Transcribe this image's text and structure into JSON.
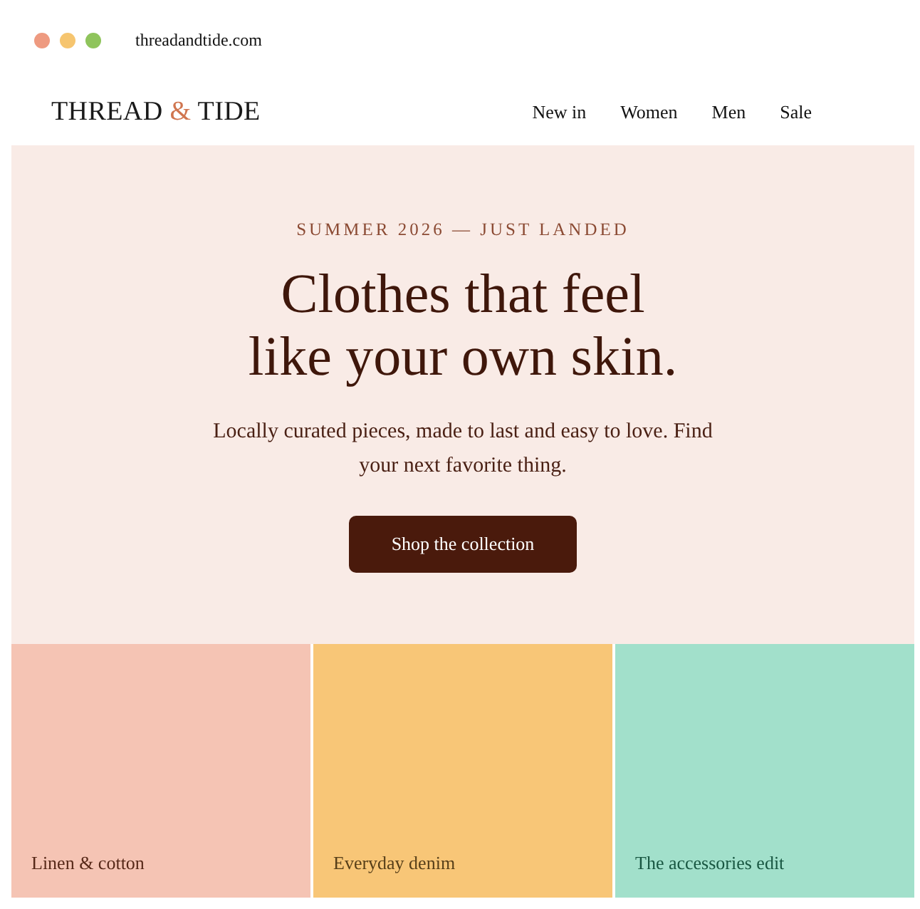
{
  "browser": {
    "dots": [
      {
        "color": "#ee9a80"
      },
      {
        "color": "#f6c56f"
      },
      {
        "color": "#8fc45c"
      }
    ],
    "url": "threadandtide.com"
  },
  "header": {
    "logo": {
      "before": "THREAD",
      "accent": "&",
      "after": "TIDE"
    },
    "nav": [
      "New in",
      "Women",
      "Men",
      "Sale"
    ]
  },
  "hero": {
    "eyebrow": "SUMMER 2026 — JUST LANDED",
    "headline": "Clothes that feel like your own skin.",
    "text": "Locally curated pieces, made to last and easy to love. Find your next favorite thing.",
    "button": "Shop the collection"
  },
  "tiles": [
    {
      "label": "Linen & cotton",
      "color": "#f5c4b4"
    },
    {
      "label": "Everyday denim",
      "color": "#f8c677"
    },
    {
      "label": "The accessories edit",
      "color": "#a2e0cb"
    }
  ]
}
